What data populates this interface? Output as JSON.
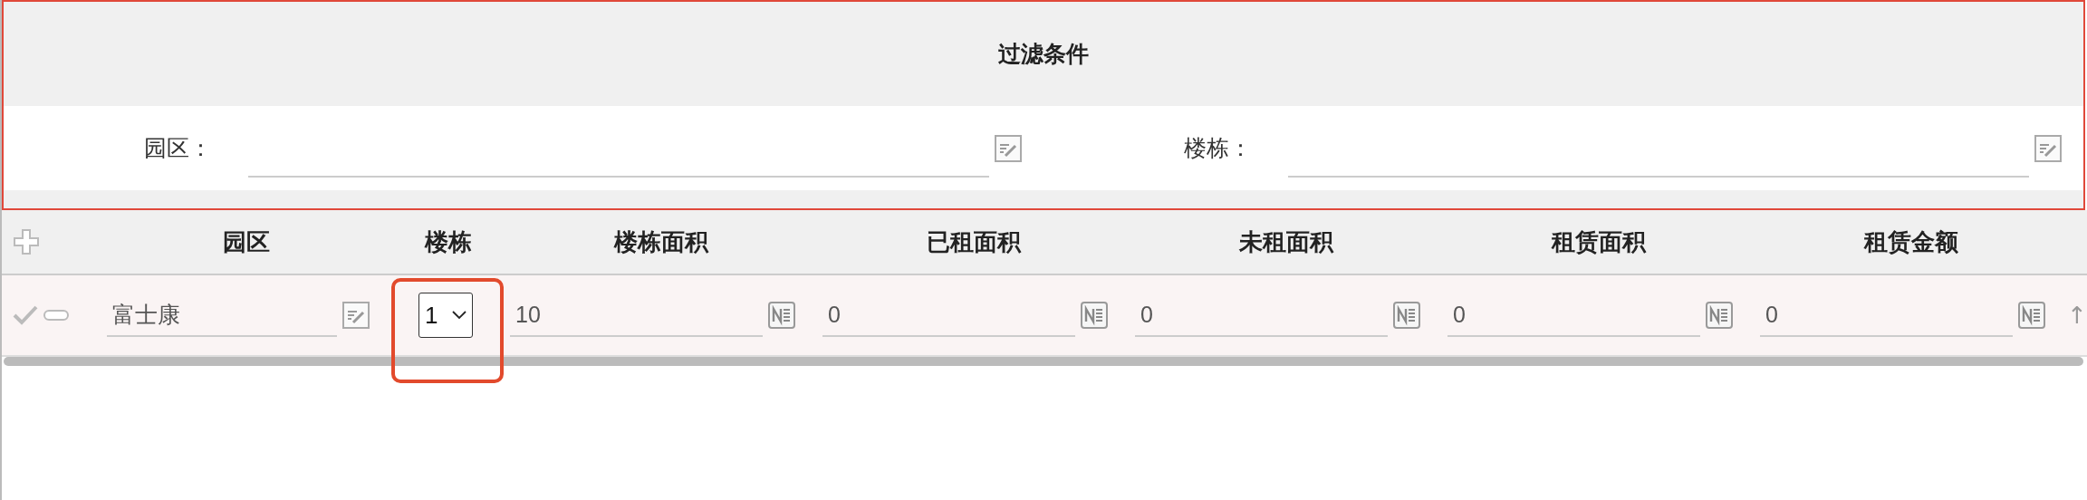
{
  "filter_panel": {
    "title": "过滤条件",
    "fields": [
      {
        "label": "园区："
      },
      {
        "label": "楼栋："
      }
    ]
  },
  "table": {
    "columns": [
      "园区",
      "楼栋",
      "楼栋面积",
      "已租面积",
      "未租面积",
      "租赁面积",
      "租赁金额"
    ],
    "rows": [
      {
        "trailing": "↑",
        "cells": [
          {
            "kind": "text",
            "value": "富士康"
          },
          {
            "kind": "select",
            "value": "1",
            "highlighted": true
          },
          {
            "kind": "number",
            "value": "10"
          },
          {
            "kind": "number",
            "value": "0"
          },
          {
            "kind": "number",
            "value": "0"
          },
          {
            "kind": "number",
            "value": "0"
          },
          {
            "kind": "number",
            "value": "0"
          }
        ]
      }
    ]
  }
}
